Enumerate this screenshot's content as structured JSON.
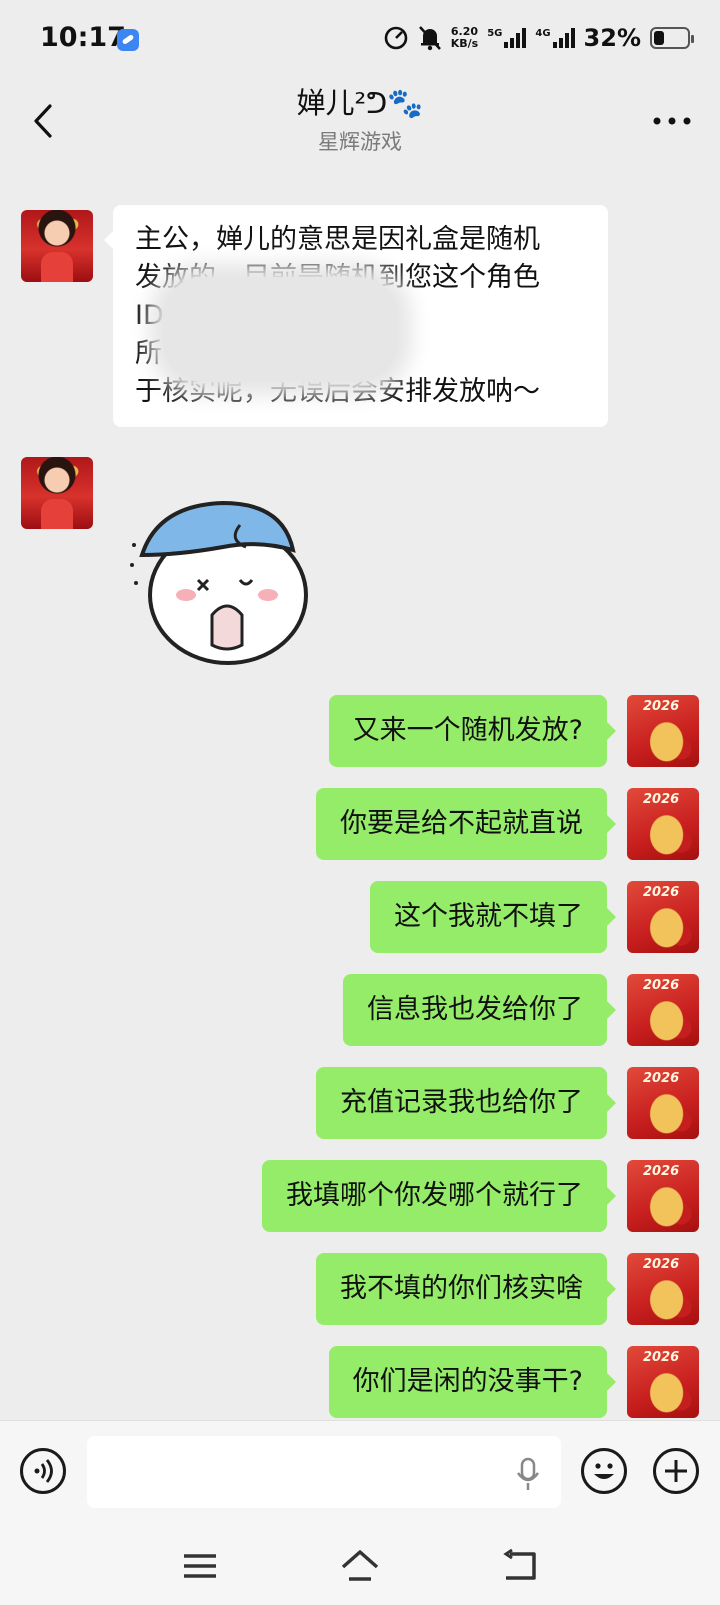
{
  "status_bar": {
    "time": "10:17",
    "speed_value": "6.20",
    "speed_unit": "KB/s",
    "net1": "5G",
    "net2": "4G",
    "battery_pct": "32%",
    "battery_level": 0.32
  },
  "header": {
    "title": "婵儿²ᕤ🐾",
    "subtitle": "星辉游戏"
  },
  "messages": {
    "incoming": [
      {
        "lines": [
          "主公，婵儿的意思是因礼盒是随机",
          "发放的，目前是随机到您这个角色",
          "ID，                     可以发放礼盒，",
          "所                      这个角色信息用",
          "于核实呢，无误后会安排发放呐～"
        ]
      }
    ],
    "outgoing": [
      "又来一个随机发放?",
      "你要是给不起就直说",
      "这个我就不填了",
      "信息我也发给你了",
      "充值记录我也给你了",
      "我填哪个你发哪个就行了",
      "我不填的你们核实啥",
      "你们是闲的没事干?"
    ]
  },
  "input": {
    "placeholder": ""
  },
  "icons": {
    "back": "back-arrow-icon",
    "more": "more-icon",
    "voice": "voice-icon",
    "mic": "microphone-icon",
    "emoji": "emoji-icon",
    "plus": "plus-icon",
    "menu": "menu-icon",
    "home": "home-icon",
    "back_nav": "back-nav-icon"
  }
}
